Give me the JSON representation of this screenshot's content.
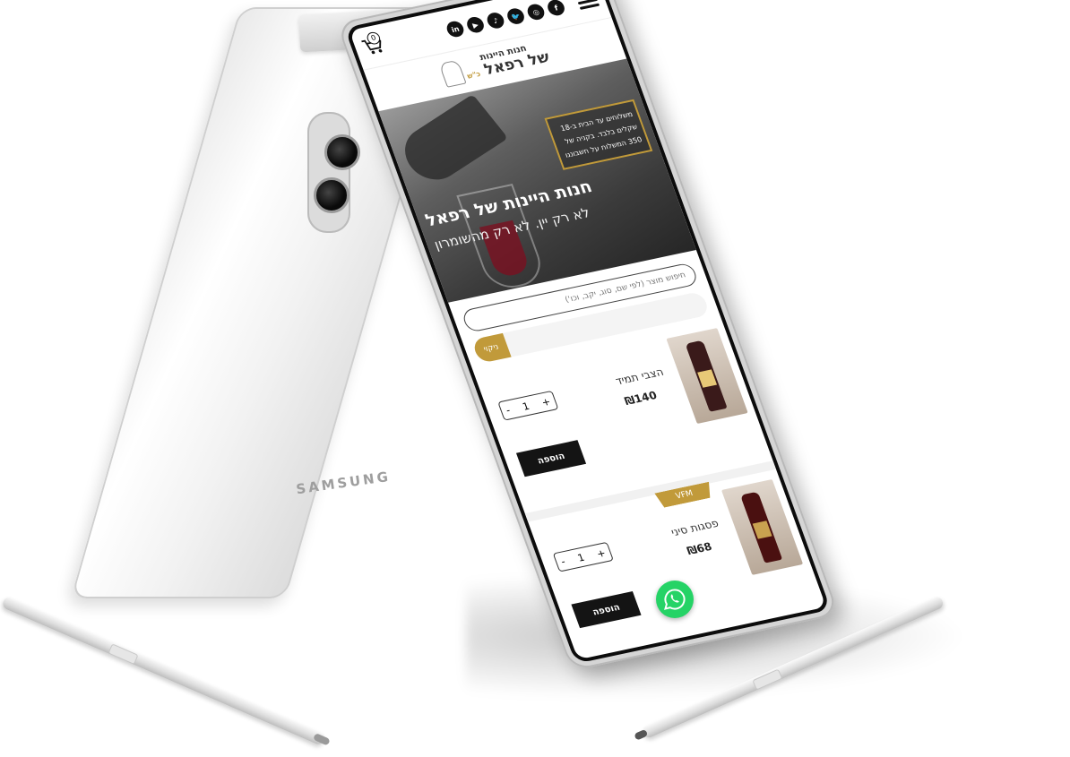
{
  "device": {
    "brand": "SAMSUNG"
  },
  "header": {
    "cart_count": "0",
    "socials": [
      "in",
      "▶",
      "♪",
      "🐦",
      "◎",
      "f"
    ]
  },
  "logo": {
    "line1": "חנות היינות",
    "line2_small": "כ\"ש",
    "line2": "של רפאל"
  },
  "hero": {
    "shipping_text": "משלוחים עד הבית ב-18 שקלים בלבד. בקניה של 350 המשלוח על חשבוננו",
    "title": "חנות היינות של רפאל",
    "subtitle": "לא רק יין. לא רק מהשומרון"
  },
  "search": {
    "placeholder": "חיפוש מוצר (לפי שם, סוג, יקב, וכו')",
    "clear_label": "ניקוי"
  },
  "products": [
    {
      "name": "הצבי תמיד",
      "price": "₪140",
      "qty": "1",
      "add_label": "הוספה",
      "badge": ""
    },
    {
      "name": "פסגות סיני",
      "price": "₪68",
      "qty": "1",
      "add_label": "הוספה",
      "badge": "VFM"
    }
  ],
  "qty_controls": {
    "plus": "+",
    "minus": "-"
  },
  "colors": {
    "gold": "#c19a3a",
    "dark": "#141414",
    "whatsapp": "#25d366"
  }
}
